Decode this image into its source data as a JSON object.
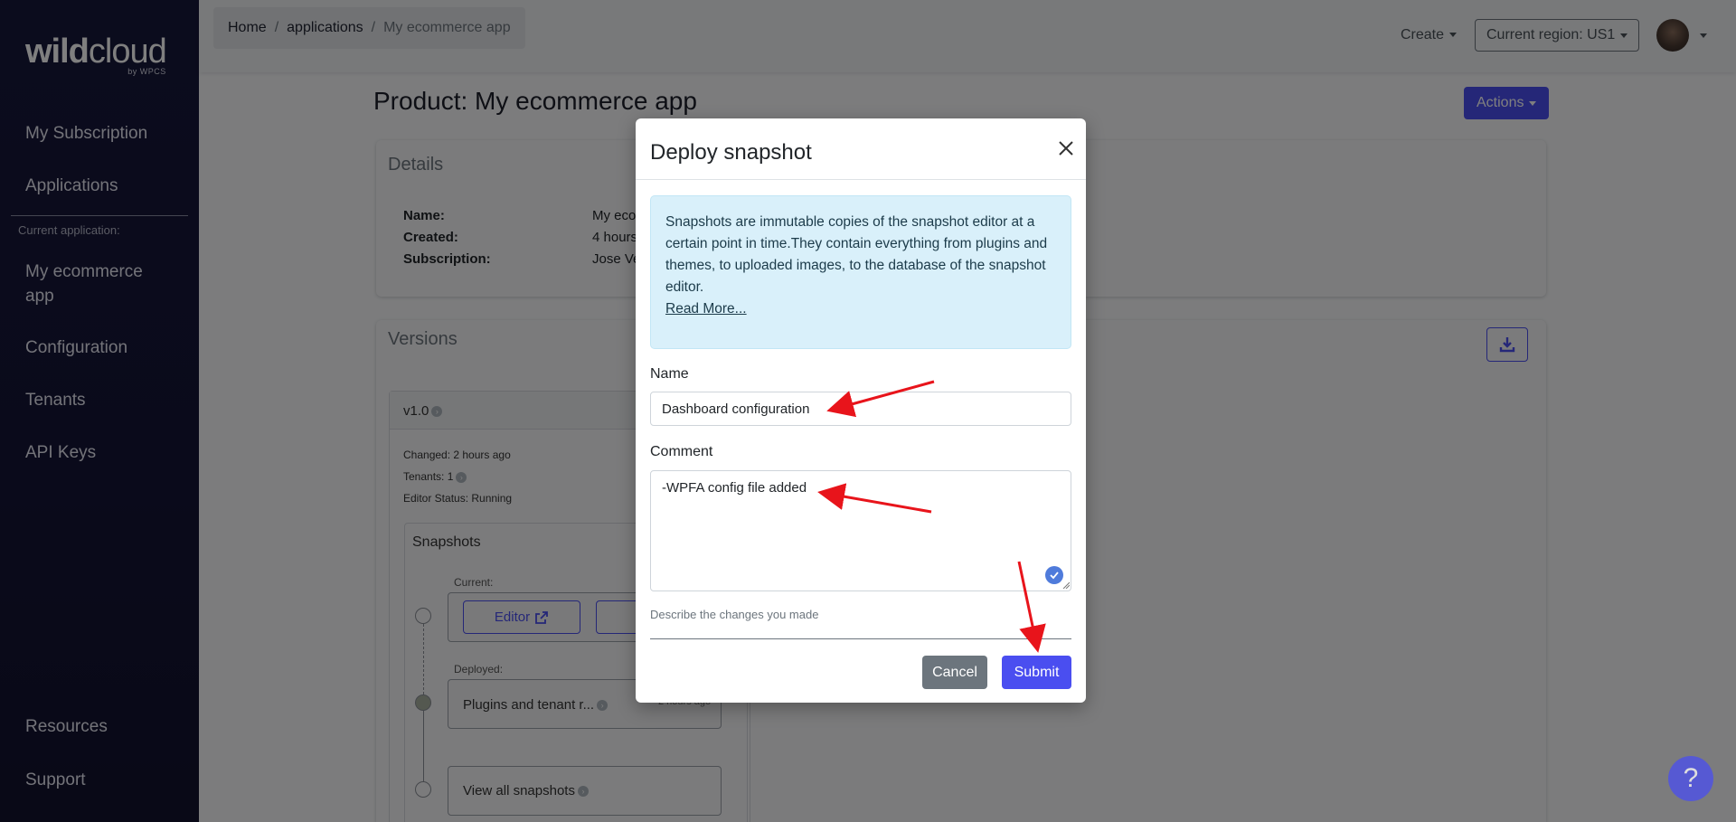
{
  "sidebar": {
    "logo_bold": "wild",
    "logo_regular": "cloud",
    "logo_sub": "by WPCS",
    "items": [
      {
        "label": "My Subscription"
      },
      {
        "label": "Applications"
      }
    ],
    "current_caption": "Current application:",
    "app_items": [
      {
        "label": "My ecommerce"
      },
      {
        "label": "app"
      },
      {
        "label": "Configuration"
      },
      {
        "label": "Tenants"
      },
      {
        "label": "API Keys"
      }
    ],
    "bottom_items": [
      {
        "label": "Resources"
      },
      {
        "label": "Support"
      }
    ]
  },
  "topbar": {
    "breadcrumb": [
      "Home",
      "applications",
      "My ecommerce app"
    ],
    "breadcrumb_sep": "/",
    "create_label": "Create",
    "region_label": "Current region: US1"
  },
  "page": {
    "title": "Product: My ecommerce app",
    "actions_label": "Actions",
    "details": {
      "title": "Details",
      "name_label": "Name:",
      "name_value": "My eco",
      "created_label": "Created:",
      "created_value": "4 hours",
      "subscription_label": "Subscription:",
      "subscription_value": "Jose Ve"
    },
    "versions": {
      "title": "Versions",
      "version_label": "v1.0",
      "changed": "Changed: 2 hours ago",
      "tenants": "Tenants: 1",
      "editor_status": "Editor Status: Running",
      "snapshots_title": "Snapshots",
      "current_label": "Current:",
      "editor_btn": "Editor",
      "deployed_label": "Deployed:",
      "deployed_item": "Plugins and tenant r...",
      "deployed_time": "2 hours ago",
      "view_all": "View all snapshots"
    }
  },
  "modal": {
    "title": "Deploy snapshot",
    "alert_text": "Snapshots are immutable copies of the snapshot editor at a certain point in time.They contain everything from plugins and themes, to uploaded images, to the database of the snapshot editor.",
    "read_more": "Read More...",
    "name_label": "Name",
    "name_value": "Dashboard configuration",
    "comment_label": "Comment",
    "comment_value": "-WPFA config file added",
    "help_text": "Describe the changes you made",
    "cancel_label": "Cancel",
    "submit_label": "Submit"
  },
  "help_button": "?",
  "colors": {
    "sidebar_bg": "#17183b",
    "accent": "#4a4ef0",
    "annotation_arrow": "#e8141b"
  }
}
